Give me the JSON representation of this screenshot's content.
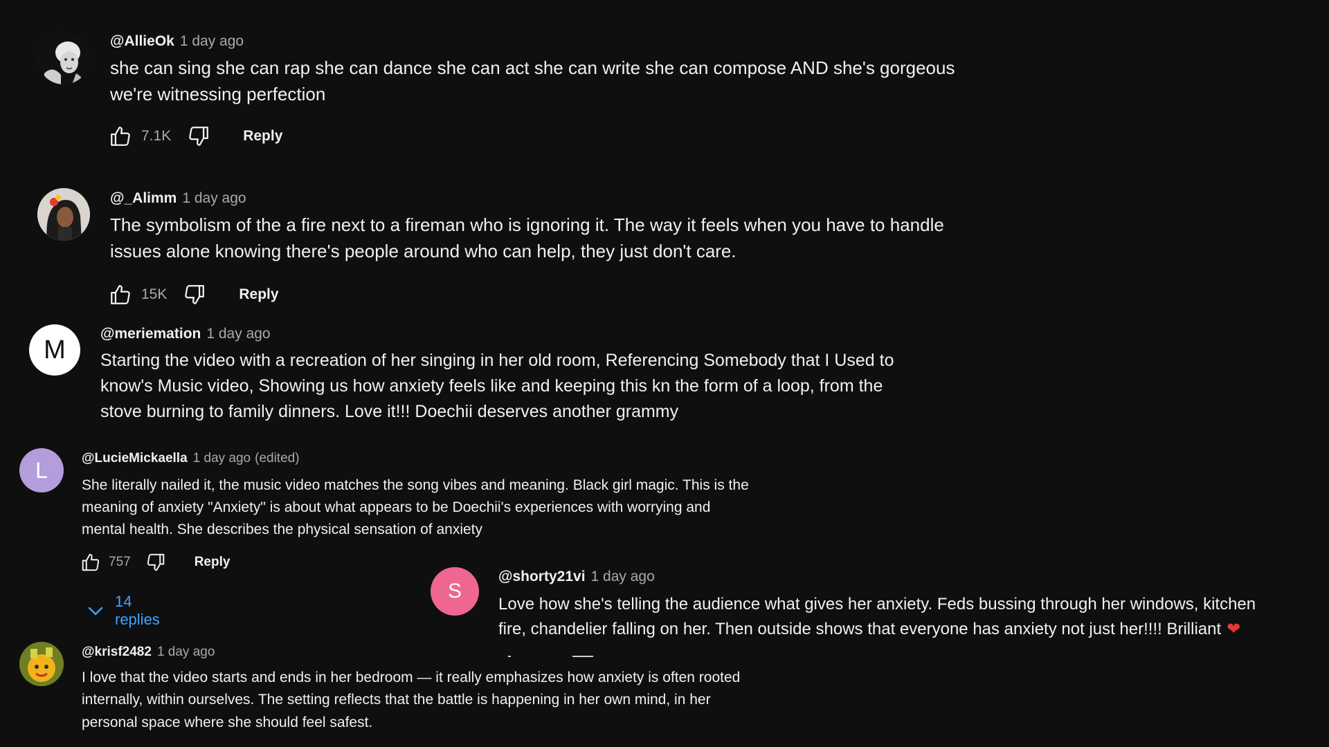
{
  "comments": [
    {
      "handle": "@AllieOk",
      "time": "1 day ago",
      "lines": [
        "she can sing she can rap she can dance she can act she can write she can compose AND she's gorgeous",
        "we're witnessing perfection"
      ],
      "likes": "7.1K",
      "reply_label": "Reply",
      "avatar": {
        "type": "image",
        "icon": "portrait-bw-icon"
      }
    },
    {
      "handle": "@_Alimm",
      "time": "1 day ago",
      "lines": [
        "The symbolism of the a fire next to a fireman who is ignoring it. The way it feels when you have to handle",
        "issues alone knowing there's people around who can help, they just don't care."
      ],
      "likes": "15K",
      "reply_label": "Reply",
      "avatar": {
        "type": "image",
        "icon": "portrait-color-icon"
      }
    },
    {
      "handle": "@meriemation",
      "time": "1 day ago",
      "lines": [
        "Starting the video with a recreation of her singing in her old room, Referencing Somebody that I Used to",
        "know's Music video, Showing us how anxiety feels like and keeping this kn the form of a loop, from the",
        "stove burning to family dinners. Love it!!! Doechii deserves another grammy"
      ],
      "avatar": {
        "type": "letter",
        "letter": "M",
        "color": "#ffffff",
        "text_color": "#0f0f0f"
      }
    },
    {
      "handle": "@LucieMickaella",
      "time": "1 day ago",
      "edited": "(edited)",
      "lines": [
        "She literally nailed it, the music video matches the song vibes and meaning. Black girl magic. This is the",
        "meaning of anxiety  \"Anxiety\" is about what appears to be Doechii's experiences with worrying and",
        "mental health. She describes the physical sensation of anxiety"
      ],
      "likes": "757",
      "reply_label": "Reply",
      "replies_label": "14 replies",
      "avatar": {
        "type": "letter",
        "letter": "L",
        "color": "#b39ddb",
        "text_color": "#ffffff"
      }
    },
    {
      "handle": "@shorty21vi",
      "time": "1 day ago",
      "lines": [
        "Love how she's telling the audience what gives her anxiety. Feds bussing through her windows, kitchen",
        "fire, chandelier falling on her. Then outside shows that everyone has anxiety not just her!!!! Brilliant"
      ],
      "heart": "❤",
      "avatar": {
        "type": "letter",
        "letter": "S",
        "color": "#ef6690",
        "text_color": "#ffffff"
      }
    },
    {
      "handle": "@krisf2482",
      "time": "1 day ago",
      "lines": [
        "I love that the video starts and ends in her bedroom — it really emphasizes how anxiety is often rooted",
        "internally, within ourselves. The setting reflects that the battle is happening in her own mind, in her",
        "personal space where she should feel safest."
      ],
      "avatar": {
        "type": "image",
        "icon": "cartoon-avatar-icon"
      }
    }
  ],
  "colors": {
    "background": "#0f0f0f",
    "text": "#f1f1f1",
    "secondary": "#aaaaaa",
    "link": "#3ea6ff",
    "heart": "#e53935"
  }
}
